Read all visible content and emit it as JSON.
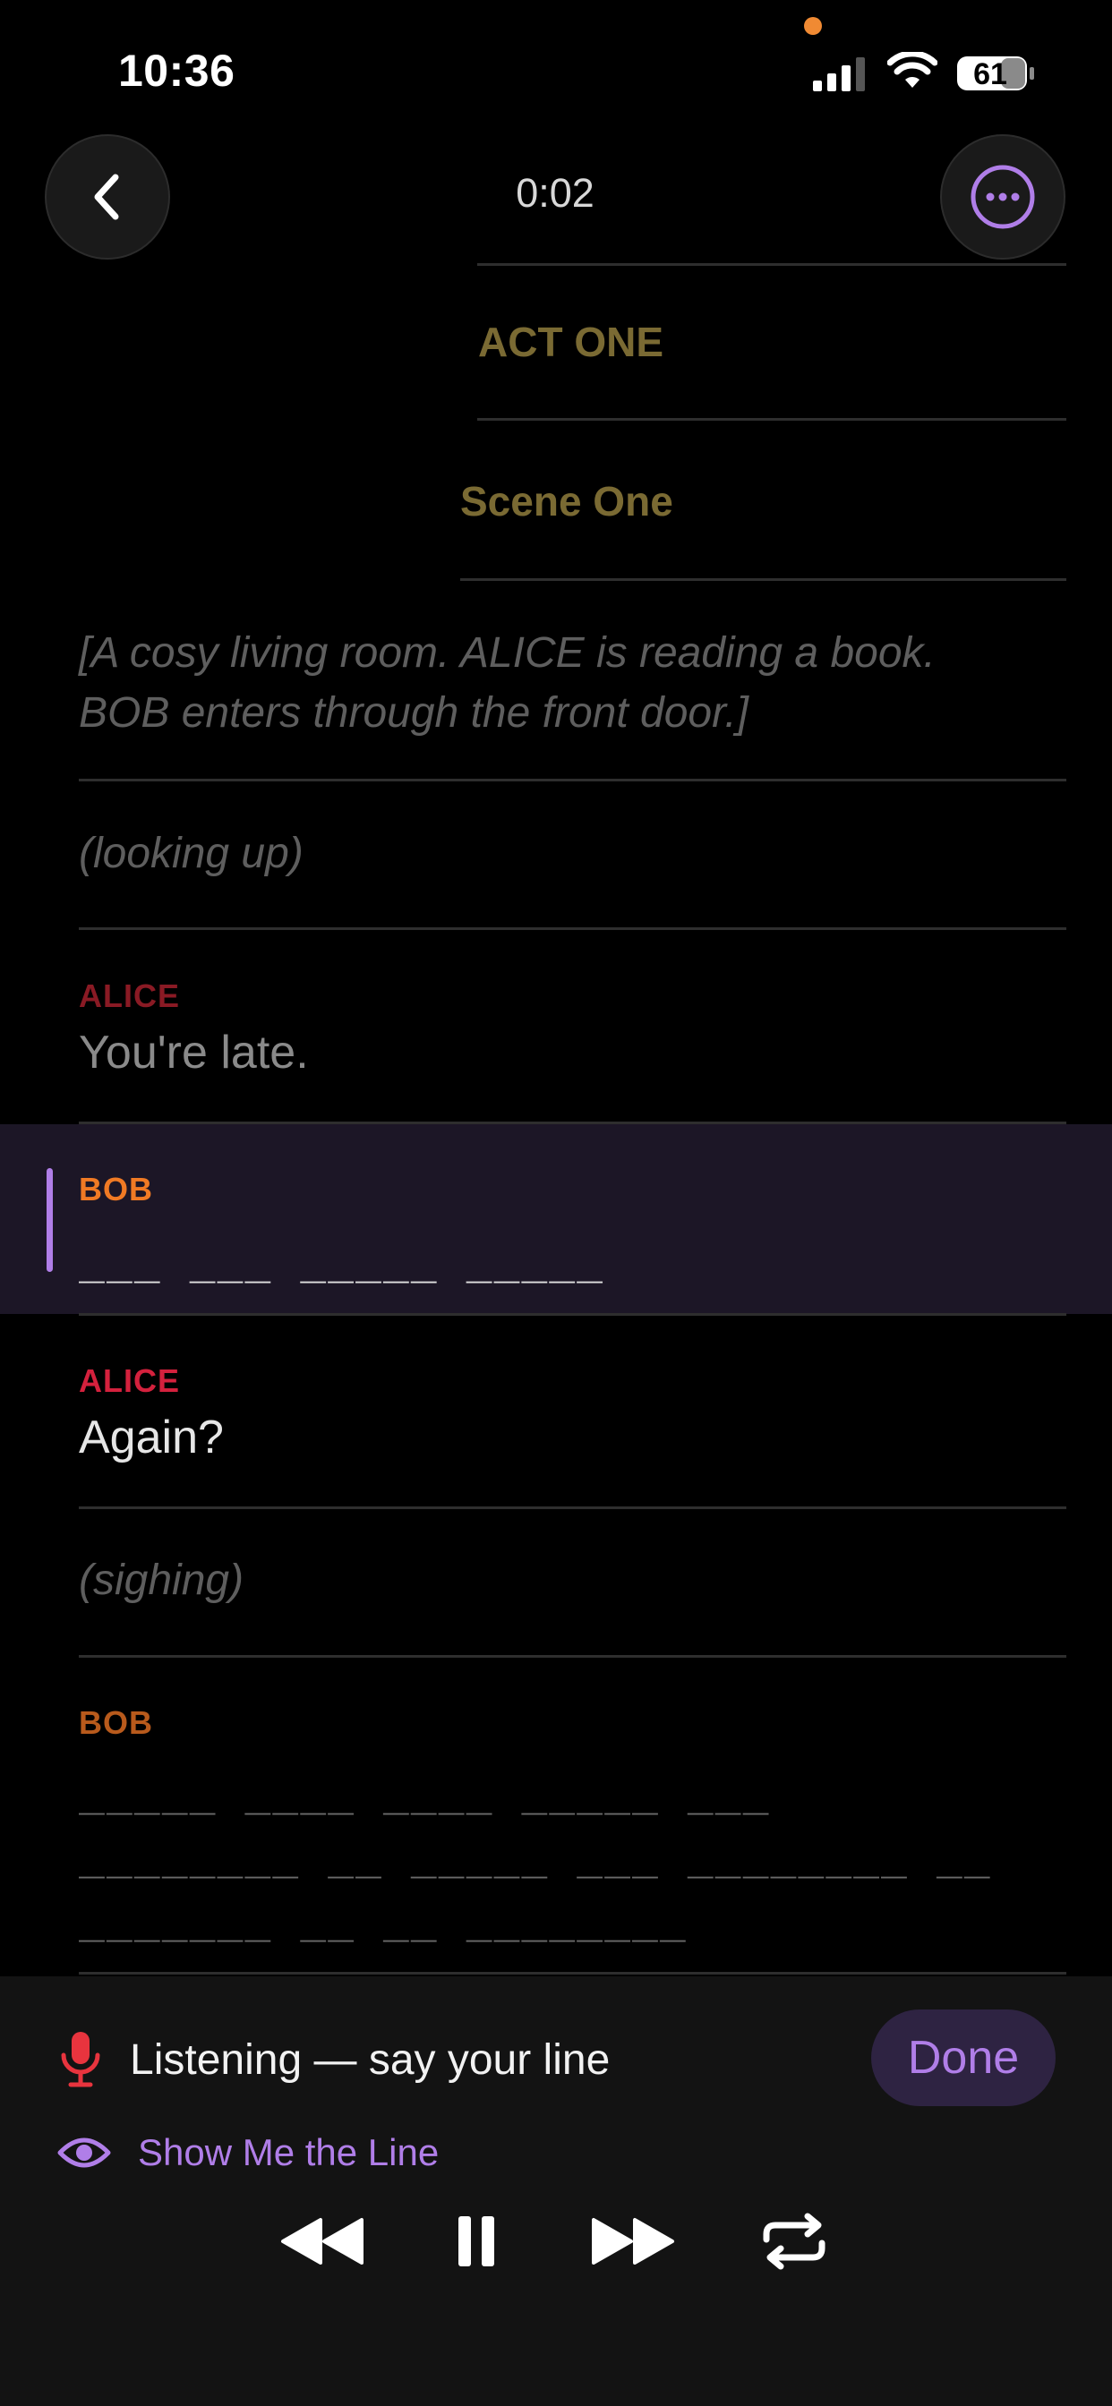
{
  "status_bar": {
    "time": "10:36",
    "battery": "61",
    "icons": [
      "signal-icon",
      "wifi-icon",
      "battery-icon"
    ]
  },
  "header": {
    "timer": "0:02",
    "back_icon": "chevron-left-icon",
    "more_icon": "ellipsis-circle-icon"
  },
  "script": {
    "act": "ACT ONE",
    "scene": "Scene One",
    "stage_direction_1": "[A cosy living room. ALICE is reading a book.",
    "stage_direction_1b": "BOB enters through the front door.]",
    "parenthetical_1": "(looking up)",
    "line_1": {
      "character": "ALICE",
      "text": "You're late."
    },
    "line_2": {
      "character": "BOB",
      "masked": "___ ___ _____ _____"
    },
    "line_3": {
      "character": "ALICE",
      "text": "Again?"
    },
    "parenthetical_2": "(sighing)",
    "line_4": {
      "character": "BOB",
      "masked_1": "_____ ____ ____ _____ ___",
      "masked_2": "________ __ _____ ___ ________ __",
      "masked_3": "_______ __ __ ________"
    }
  },
  "panel": {
    "listening": "Listening — say your line",
    "done": "Done",
    "show_line": "Show Me the Line",
    "controls": [
      "rewind-icon",
      "pause-icon",
      "fast-forward-icon",
      "repeat-icon"
    ]
  },
  "colors": {
    "accent": "#b07ee8",
    "alice": "#d4213d",
    "bob": "#f07a24",
    "heading": "#7a6a33"
  }
}
